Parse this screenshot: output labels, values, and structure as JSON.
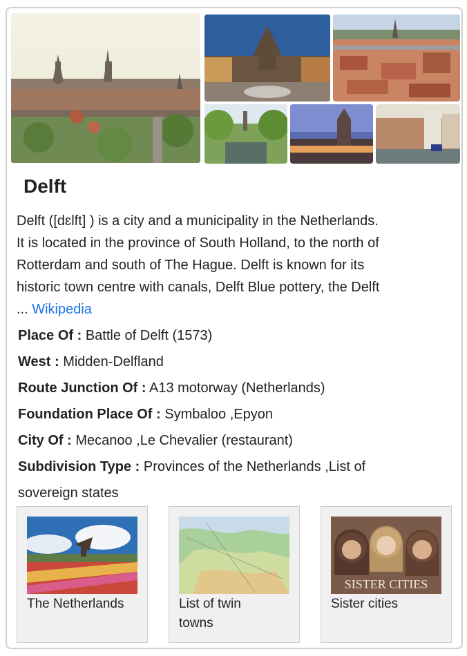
{
  "entity": {
    "title": "Delft",
    "description_lines": [
      "Delft ([dɛlft] ) is a city and a municipality in the Netherlands.",
      "It is located in the province of South Holland, to the north of",
      "Rotterdam and south of The Hague. Delft is known for its",
      "historic town centre with canals, Delft Blue pottery, the Delft"
    ],
    "ellipsis": "...",
    "source_link": "Wikipedia"
  },
  "gallery": {
    "images": [
      {
        "name": "delft-skyline-image"
      },
      {
        "name": "market-square-night-image"
      },
      {
        "name": "aerial-rooftops-image"
      },
      {
        "name": "canal-trees-image"
      },
      {
        "name": "city-hall-dusk-image"
      },
      {
        "name": "canal-houses-image"
      }
    ]
  },
  "facts": [
    {
      "label": "Place Of :",
      "value": "Battle of Delft (1573)"
    },
    {
      "label": "West :",
      "value": "Midden-Delfland"
    },
    {
      "label": "Route Junction Of :",
      "value": "A13 motorway (Netherlands)"
    },
    {
      "label": "Foundation Place Of :",
      "value": "Symbaloo ,Epyon"
    },
    {
      "label": "City Of :",
      "value": "Mecanoo ,Le Chevalier (restaurant)"
    },
    {
      "label": "Subdivision Type :",
      "value": "Provinces of the Netherlands ,List of",
      "value_cont": "sovereign states"
    }
  ],
  "related": [
    {
      "label_lines": [
        "The Netherlands"
      ],
      "thumb_caption": ""
    },
    {
      "label_lines": [
        "List of twin",
        "towns"
      ],
      "thumb_caption": ""
    },
    {
      "label_lines": [
        "Sister cities"
      ],
      "thumb_caption": "SISTER CITIES"
    }
  ],
  "colors": {
    "link": "#1a73e8",
    "border": "#cfcfcf",
    "card_bg": "#f0f0f0"
  }
}
